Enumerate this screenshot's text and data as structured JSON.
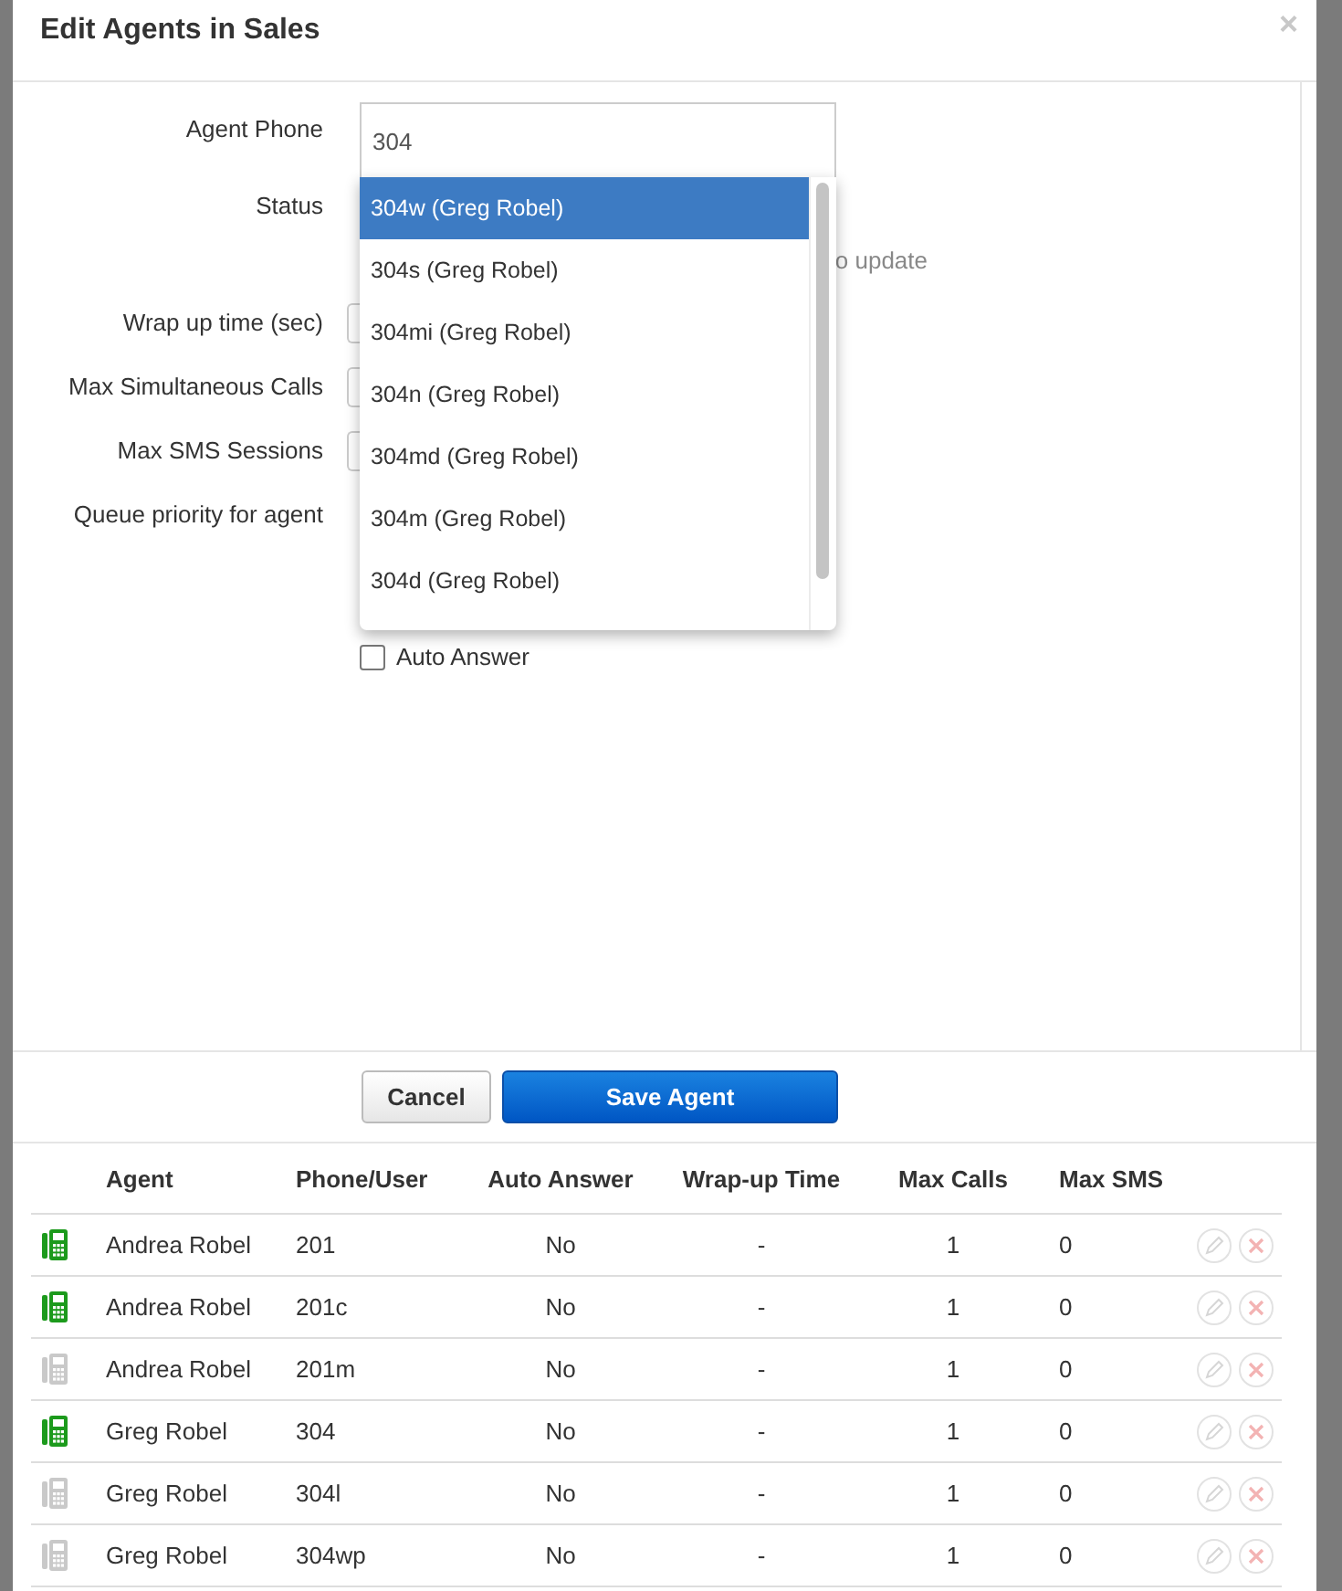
{
  "dialog": {
    "title": "Edit Agents in Sales",
    "close": "×"
  },
  "form": {
    "agent_phone": {
      "label": "Agent Phone",
      "value": "304"
    },
    "suggestions": [
      {
        "text": "304w (Greg Robel)",
        "selected": true
      },
      {
        "text": "304s (Greg Robel)",
        "selected": false
      },
      {
        "text": "304mi (Greg Robel)",
        "selected": false
      },
      {
        "text": "304n (Greg Robel)",
        "selected": false
      },
      {
        "text": "304md (Greg Robel)",
        "selected": false
      },
      {
        "text": "304m (Greg Robel)",
        "selected": false
      },
      {
        "text": "304d (Greg Robel)",
        "selected": false
      }
    ],
    "status_label": "Status",
    "status_hint": "o update",
    "fields": [
      {
        "label": "Wrap up time (sec)"
      },
      {
        "label": "Max Simultaneous Calls"
      },
      {
        "label": "Max SMS Sessions"
      },
      {
        "label": "Queue priority for agent"
      }
    ],
    "auto_answer": {
      "label": "Auto Answer",
      "checked": false
    }
  },
  "buttons": {
    "cancel": "Cancel",
    "save": "Save Agent"
  },
  "table": {
    "columns": [
      "Agent",
      "Phone/User",
      "Auto Answer",
      "Wrap-up Time",
      "Max Calls",
      "Max SMS"
    ],
    "rows": [
      {
        "online": true,
        "agent": "Andrea Robel",
        "phone": "201",
        "auto_answer": "No",
        "wrap_up": "-",
        "max_calls": "1",
        "max_sms": "0"
      },
      {
        "online": true,
        "agent": "Andrea Robel",
        "phone": "201c",
        "auto_answer": "No",
        "wrap_up": "-",
        "max_calls": "1",
        "max_sms": "0"
      },
      {
        "online": false,
        "agent": "Andrea Robel",
        "phone": "201m",
        "auto_answer": "No",
        "wrap_up": "-",
        "max_calls": "1",
        "max_sms": "0"
      },
      {
        "online": true,
        "agent": "Greg Robel",
        "phone": "304",
        "auto_answer": "No",
        "wrap_up": "-",
        "max_calls": "1",
        "max_sms": "0"
      },
      {
        "online": false,
        "agent": "Greg Robel",
        "phone": "304l",
        "auto_answer": "No",
        "wrap_up": "-",
        "max_calls": "1",
        "max_sms": "0"
      },
      {
        "online": false,
        "agent": "Greg Robel",
        "phone": "304wp",
        "auto_answer": "No",
        "wrap_up": "-",
        "max_calls": "1",
        "max_sms": "0"
      }
    ]
  }
}
